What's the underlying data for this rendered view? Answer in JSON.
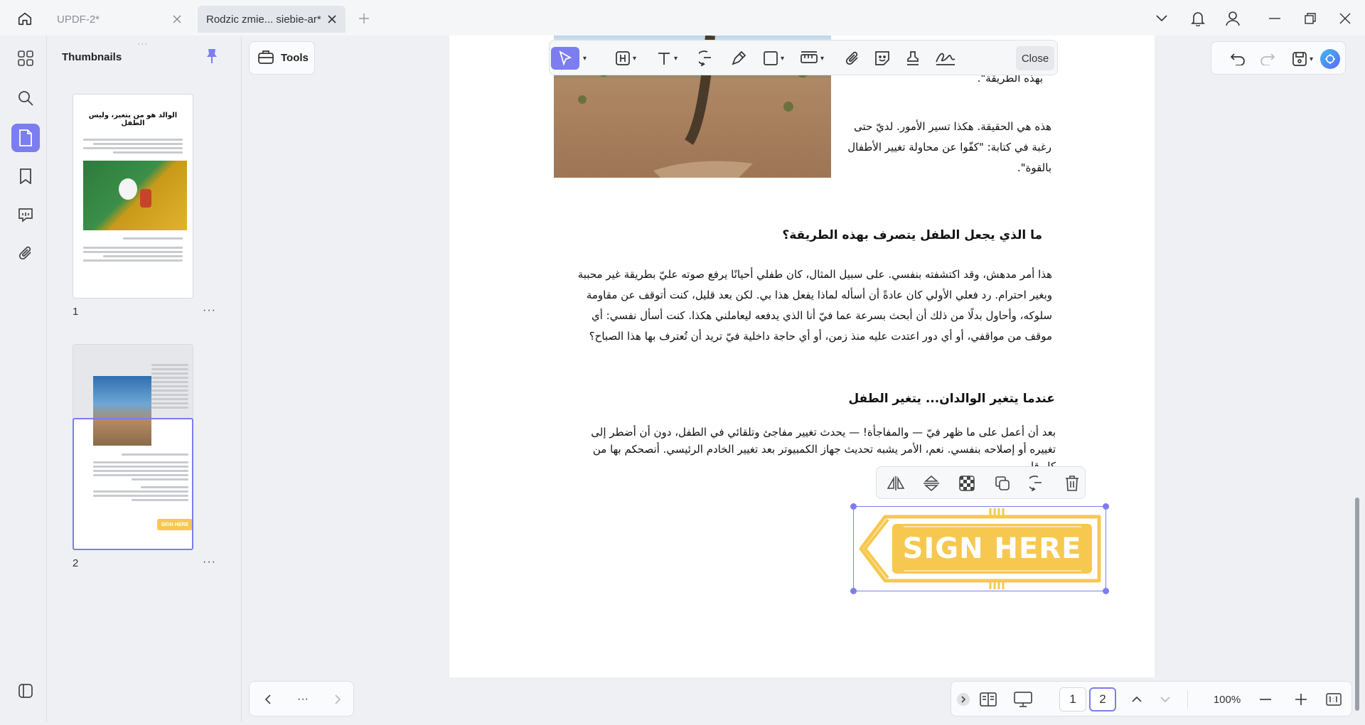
{
  "titlebar": {
    "tabs": [
      {
        "label": "UPDF-2*"
      },
      {
        "label": "Rodzic zmie... siebie-ar*"
      }
    ]
  },
  "sidebar": {
    "panel_title": "Thumbnails",
    "pages": [
      {
        "number": "1",
        "title": "الوالد هو من يتغير، وليس الطفل"
      },
      {
        "number": "2",
        "title": "",
        "stamp_text": "SIGN HERE"
      }
    ],
    "more_label": "···"
  },
  "toolbar": {
    "tools_label": "Tools",
    "close_label": "Close"
  },
  "document": {
    "para1": "هذه هي الحقيقة. هكذا تسير الأمور. لديّ حتى رغبة في كتابة: \"كفّوا عن محاولة تغيير الأطفال بالقوة\".",
    "para0": "بهذه الطريقة\".",
    "heading1": "ما الذي يجعل الطفل يتصرف بهذه الطريقة؟",
    "para2": "هذا أمر مدهش، وقد اكتشفته بنفسي. على سبيل المثال، كان طفلي أحيانًا يرفع صوته عليّ بطريقة غير محببة وبغير احترام. رد فعلي الأولي كان عادةً أن أسأله لماذا يفعل هذا بي. لكن بعد قليل، كنت أتوقف عن مقاومة سلوكه، وأحاول بدلًا من ذلك أن أبحث بسرعة عما فيّ أنا الذي يدفعه ليعاملني هكذا. كنت أسأل نفسي: أي موقف من مواقفي، أو أي دور اعتدت عليه منذ زمن، أو أي حاجة داخلية فيّ تريد أن تُعترف بها هذا الصباح؟",
    "heading2": "عندما يتغير الوالدان... يتغير الطفل",
    "para3": "بعد أن أعمل على ما ظهر فيّ — والمفاجأة! — يحدث تغيير مفاجئ وتلقائي في الطفل، دون أن أضطر إلى تغييره أو إصلاحه بنفسي. نعم، الأمر يشبه تحديث جهاز الكمبيوتر بعد تغيير الخادم الرئيسي. أنصحكم بها من كل قلبي.",
    "stamp_text": "SIGN HERE"
  },
  "bottombar": {
    "more_label": "···",
    "pages": [
      "1",
      "2"
    ],
    "current_page": "2",
    "zoom": "100%"
  },
  "colors": {
    "accent": "#7b7df0",
    "stamp": "#f7c84f",
    "page_bg": "#ffffff",
    "app_bg": "#eef0f3"
  }
}
